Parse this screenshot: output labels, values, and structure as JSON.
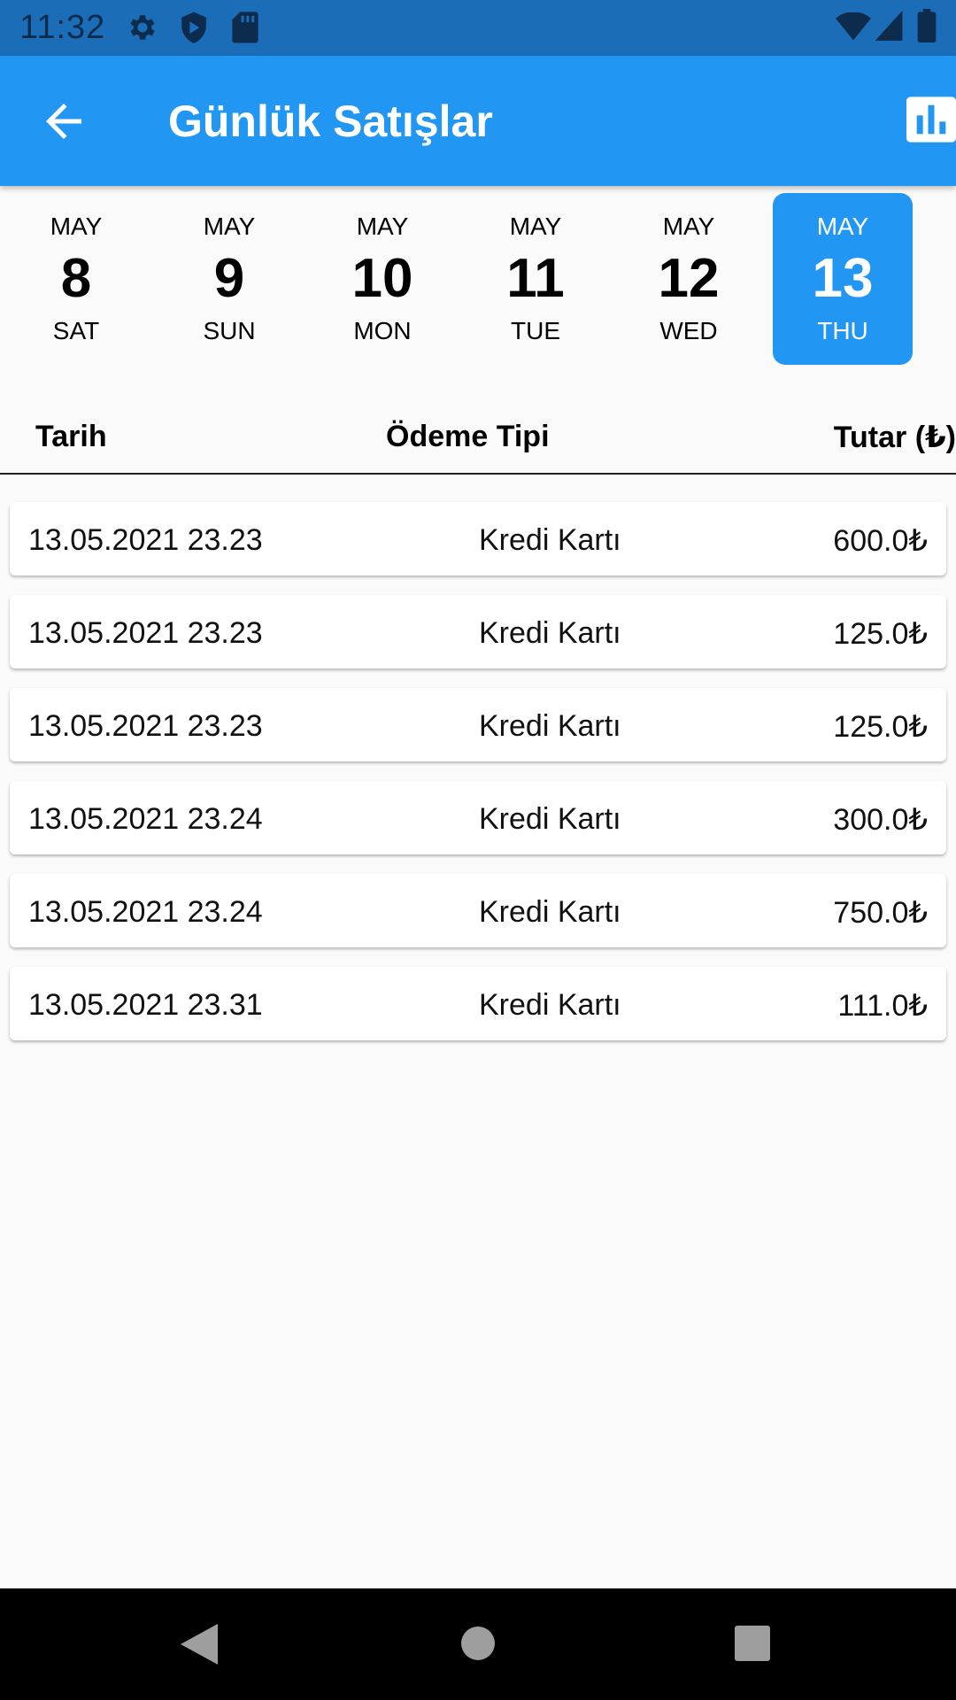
{
  "status_bar": {
    "time": "11:32",
    "icons_left": [
      "gear-icon",
      "shield-icon",
      "sd-card-icon"
    ],
    "icons_right": [
      "wifi-icon",
      "signal-icon",
      "battery-icon"
    ]
  },
  "app_bar": {
    "title": "Günlük Satışlar",
    "back_icon": "arrow-back-icon",
    "action_icon": "bar-chart-icon",
    "color": "#2196f3"
  },
  "date_picker": {
    "selected_index": 5,
    "items": [
      {
        "month": "MAY",
        "day": "8",
        "weekday": "SAT"
      },
      {
        "month": "MAY",
        "day": "9",
        "weekday": "SUN"
      },
      {
        "month": "MAY",
        "day": "10",
        "weekday": "MON"
      },
      {
        "month": "MAY",
        "day": "11",
        "weekday": "TUE"
      },
      {
        "month": "MAY",
        "day": "12",
        "weekday": "WED"
      },
      {
        "month": "MAY",
        "day": "13",
        "weekday": "THU"
      }
    ]
  },
  "table": {
    "headers": [
      "Tarih",
      "Ödeme Tipi",
      "Tutar (₺)"
    ],
    "rows": [
      {
        "date": "13.05.2021 23.23",
        "type": "Kredi Kartı",
        "amount": "600.0₺"
      },
      {
        "date": "13.05.2021 23.23",
        "type": "Kredi Kartı",
        "amount": "125.0₺"
      },
      {
        "date": "13.05.2021 23.23",
        "type": "Kredi Kartı",
        "amount": "125.0₺"
      },
      {
        "date": "13.05.2021 23.24",
        "type": "Kredi Kartı",
        "amount": "300.0₺"
      },
      {
        "date": "13.05.2021 23.24",
        "type": "Kredi Kartı",
        "amount": "750.0₺"
      },
      {
        "date": "13.05.2021 23.31",
        "type": "Kredi Kartı",
        "amount": "111.0₺"
      }
    ]
  },
  "nav_bar": {
    "icons": [
      "back-nav-icon",
      "home-nav-icon",
      "recents-nav-icon"
    ]
  }
}
